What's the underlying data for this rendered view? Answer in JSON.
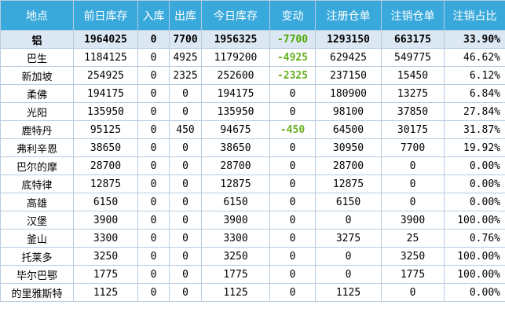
{
  "headers": [
    "地点",
    "前日库存",
    "入库",
    "出库",
    "今日库存",
    "变动",
    "注册仓单",
    "注销仓单",
    "注销占比"
  ],
  "total": {
    "location": "铝",
    "prev": "1964025",
    "in": "0",
    "out": "7700",
    "today": "1956325",
    "change": "-7700",
    "registered": "1293150",
    "cancelled": "663175",
    "ratio": "33.90%"
  },
  "rows": [
    {
      "location": "巴生",
      "prev": "1184125",
      "in": "0",
      "out": "4925",
      "today": "1179200",
      "change": "-4925",
      "registered": "629425",
      "cancelled": "549775",
      "ratio": "46.62%"
    },
    {
      "location": "新加坡",
      "prev": "254925",
      "in": "0",
      "out": "2325",
      "today": "252600",
      "change": "-2325",
      "registered": "237150",
      "cancelled": "15450",
      "ratio": "6.12%"
    },
    {
      "location": "柔佛",
      "prev": "194175",
      "in": "0",
      "out": "0",
      "today": "194175",
      "change": "0",
      "registered": "180900",
      "cancelled": "13275",
      "ratio": "6.84%"
    },
    {
      "location": "光阳",
      "prev": "135950",
      "in": "0",
      "out": "0",
      "today": "135950",
      "change": "0",
      "registered": "98100",
      "cancelled": "37850",
      "ratio": "27.84%"
    },
    {
      "location": "鹿特丹",
      "prev": "95125",
      "in": "0",
      "out": "450",
      "today": "94675",
      "change": "-450",
      "registered": "64500",
      "cancelled": "30175",
      "ratio": "31.87%"
    },
    {
      "location": "弗利辛恩",
      "prev": "38650",
      "in": "0",
      "out": "0",
      "today": "38650",
      "change": "0",
      "registered": "30950",
      "cancelled": "7700",
      "ratio": "19.92%"
    },
    {
      "location": "巴尔的摩",
      "prev": "28700",
      "in": "0",
      "out": "0",
      "today": "28700",
      "change": "0",
      "registered": "28700",
      "cancelled": "0",
      "ratio": "0.00%"
    },
    {
      "location": "底特律",
      "prev": "12875",
      "in": "0",
      "out": "0",
      "today": "12875",
      "change": "0",
      "registered": "12875",
      "cancelled": "0",
      "ratio": "0.00%"
    },
    {
      "location": "高雄",
      "prev": "6150",
      "in": "0",
      "out": "0",
      "today": "6150",
      "change": "0",
      "registered": "6150",
      "cancelled": "0",
      "ratio": "0.00%"
    },
    {
      "location": "汉堡",
      "prev": "3900",
      "in": "0",
      "out": "0",
      "today": "3900",
      "change": "0",
      "registered": "0",
      "cancelled": "3900",
      "ratio": "100.00%"
    },
    {
      "location": "釜山",
      "prev": "3300",
      "in": "0",
      "out": "0",
      "today": "3300",
      "change": "0",
      "registered": "3275",
      "cancelled": "25",
      "ratio": "0.76%"
    },
    {
      "location": "托莱多",
      "prev": "3250",
      "in": "0",
      "out": "0",
      "today": "3250",
      "change": "0",
      "registered": "0",
      "cancelled": "3250",
      "ratio": "100.00%"
    },
    {
      "location": "毕尔巴鄂",
      "prev": "1775",
      "in": "0",
      "out": "0",
      "today": "1775",
      "change": "0",
      "registered": "0",
      "cancelled": "1775",
      "ratio": "100.00%"
    },
    {
      "location": "的里雅斯特",
      "prev": "1125",
      "in": "0",
      "out": "0",
      "today": "1125",
      "change": "0",
      "registered": "1125",
      "cancelled": "0",
      "ratio": "0.00%"
    }
  ]
}
